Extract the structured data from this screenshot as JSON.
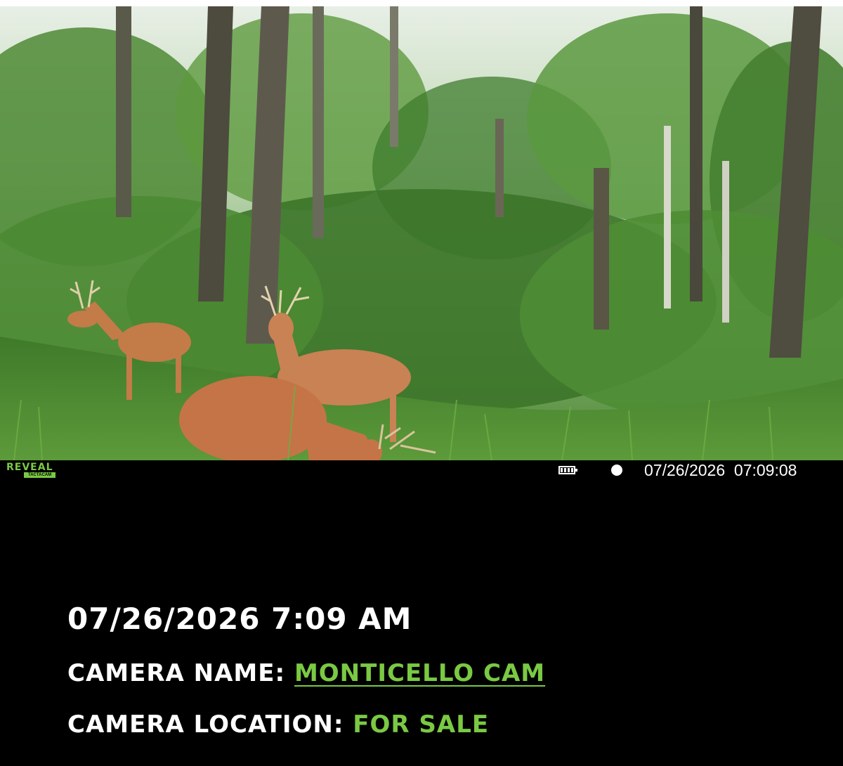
{
  "image": {
    "timestamp_overlay": {
      "date": "07/26/2026",
      "time": "07:09:08"
    },
    "brand": {
      "name": "REVEAL",
      "sub": "TACTACAM"
    },
    "status_icons": [
      "battery-icon",
      "record-dot-icon"
    ]
  },
  "details": {
    "datetime": "07/26/2026 7:09 AM",
    "camera_name_label": "CAMERA NAME:",
    "camera_name_value": "MONTICELLO CAM",
    "camera_location_label": "CAMERA LOCATION:",
    "camera_location_value": "FOR SALE"
  },
  "colors": {
    "accent": "#7ac943",
    "background": "#000000",
    "text": "#ffffff"
  }
}
